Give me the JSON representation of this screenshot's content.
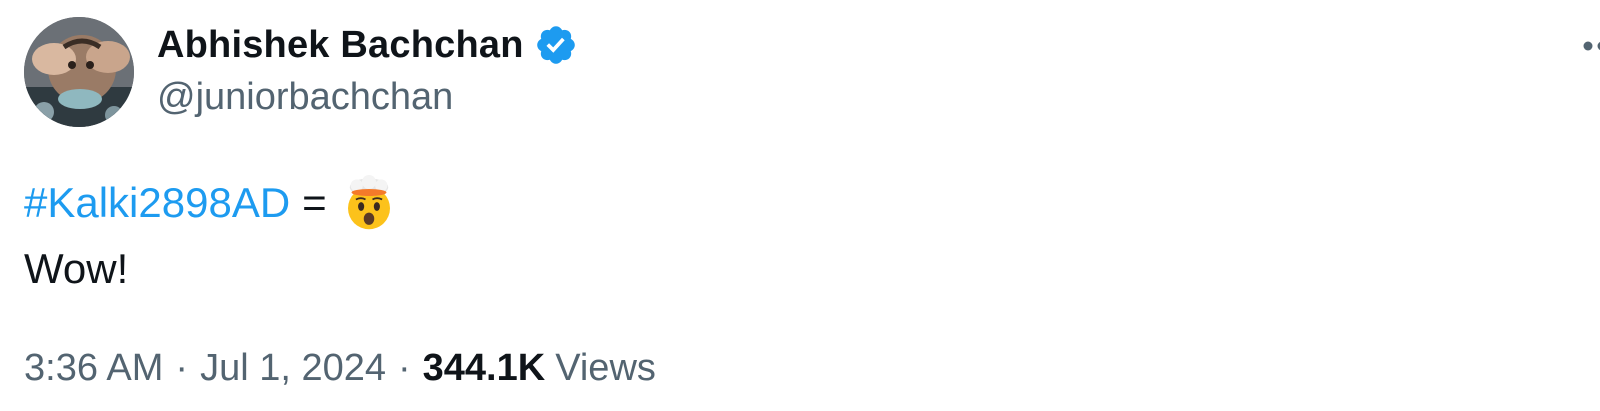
{
  "tweet": {
    "author": {
      "display_name": "Abhishek Bachchan",
      "handle": "@juniorbachchan",
      "verified": true,
      "avatar_icon": "profile-photo"
    },
    "text": {
      "hashtag": "#Kalki2898AD",
      "equals": "=",
      "emoji": "exploding-head-emoji",
      "line2": "Wow!"
    },
    "meta": {
      "time": "3:36 AM",
      "separator": "·",
      "date": "Jul 1, 2024",
      "views_count": "344.1K",
      "views_label": "Views"
    },
    "more_icon": "more-horizontal-icon"
  },
  "colors": {
    "text_primary": "#0f1419",
    "text_secondary": "#536471",
    "link": "#1d9bf0",
    "verified_badge": "#1d9bf0"
  }
}
